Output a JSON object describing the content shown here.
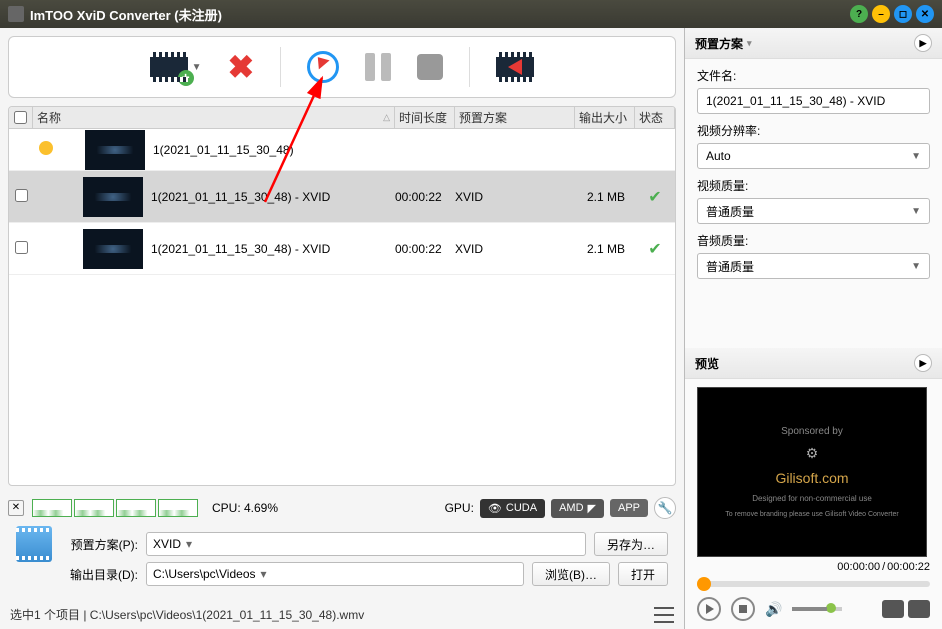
{
  "title": "ImTOO XviD Converter (未注册)",
  "toolbar": {},
  "columns": {
    "name": "名称",
    "time": "时间长度",
    "preset": "预置方案",
    "size": "输出大小",
    "status": "状态"
  },
  "rows": [
    {
      "kind": "parent",
      "name": "1(2021_01_11_15_30_48)",
      "time": "",
      "preset": "",
      "size": "",
      "status": ""
    },
    {
      "kind": "child",
      "selected": true,
      "name": "1(2021_01_11_15_30_48) - XVID",
      "time": "00:00:22",
      "preset": "XVID",
      "size": "2.1 MB",
      "status": "✔"
    },
    {
      "kind": "child",
      "selected": false,
      "name": "1(2021_01_11_15_30_48) - XVID",
      "time": "00:00:22",
      "preset": "XVID",
      "size": "2.1 MB",
      "status": "✔"
    }
  ],
  "cpu": {
    "label": "CPU: 4.69%",
    "gpu_label": "GPU:",
    "cuda": "CUDA",
    "amd": "AMD",
    "app": "APP"
  },
  "form": {
    "preset_lbl": "预置方案(P):",
    "preset_val": "XVID",
    "saveas": "另存为…",
    "outdir_lbl": "输出目录(D):",
    "outdir_val": "C:\\Users\\pc\\Videos",
    "browse": "浏览(B)…",
    "open": "打开"
  },
  "status_bar": "选中1 个项目 | C:\\Users\\pc\\Videos\\1(2021_01_11_15_30_48).wmv",
  "right": {
    "preset_hdr": "预置方案",
    "filename_lbl": "文件名:",
    "filename_val": "1(2021_01_11_15_30_48) - XVID",
    "res_lbl": "视频分辨率:",
    "res_val": "Auto",
    "vq_lbl": "视频质量:",
    "vq_val": "普通质量",
    "aq_lbl": "音频质量:",
    "aq_val": "普通质量",
    "preview_hdr": "预览",
    "preview_text1": "Sponsored by",
    "preview_brand": "Gilisoft.com",
    "preview_text2": "Designed for non-commercial use",
    "preview_text3": "To remove branding please use Gilisoft Video Converter",
    "time_cur": "00:00:00",
    "time_sep": " / ",
    "time_total": "00:00:22"
  }
}
